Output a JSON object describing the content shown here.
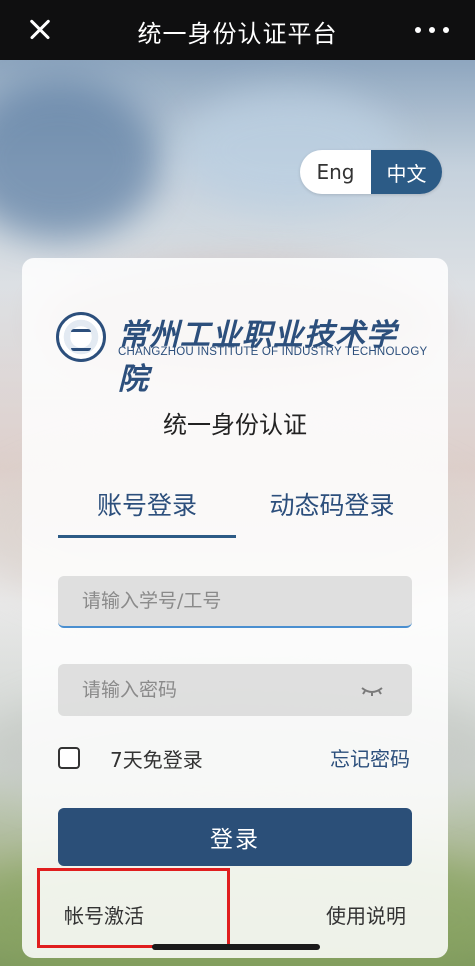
{
  "topbar": {
    "title": "统一身份认证平台",
    "close_icon": "close-icon",
    "more_icon": "more-icon"
  },
  "lang": {
    "eng": "Eng",
    "zh": "中文",
    "active": "zh"
  },
  "logo": {
    "cn": "常州工业职业技术学院",
    "en": "CHANGZHOU INSTITUTE OF INDUSTRY TECHNOLOGY"
  },
  "auth_title": "统一身份认证",
  "tabs": [
    {
      "label": "账号登录",
      "active": true
    },
    {
      "label": "动态码登录",
      "active": false
    }
  ],
  "form": {
    "username_placeholder": "请输入学号/工号",
    "password_placeholder": "请输入密码",
    "remember_label": "7天免登录",
    "forgot_label": "忘记密码",
    "login_label": "登录"
  },
  "footer": {
    "activate_label": "帐号激活",
    "help_label": "使用说明"
  },
  "colors": {
    "accent": "#2c5b86",
    "button": "#2b4f78",
    "highlight": "#e01e1e"
  }
}
